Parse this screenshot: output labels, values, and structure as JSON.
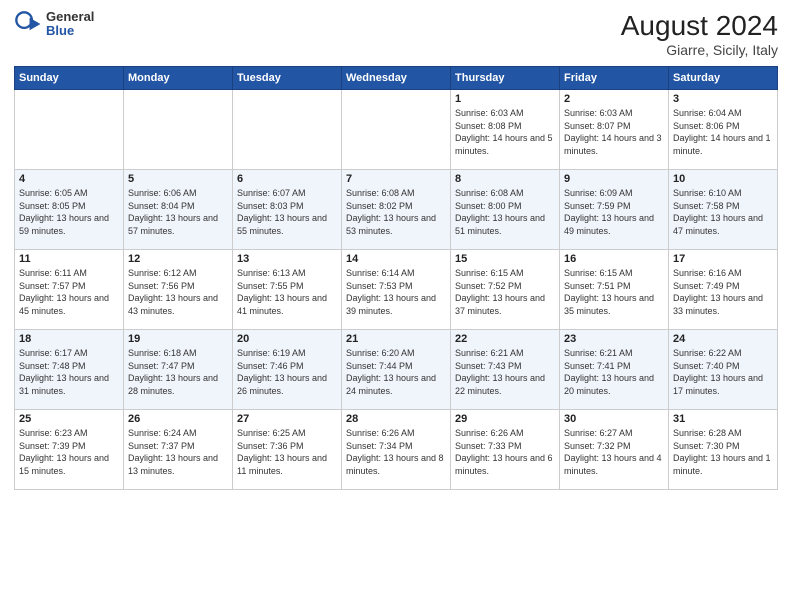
{
  "header": {
    "logo_general": "General",
    "logo_blue": "Blue",
    "title": "August 2024",
    "subtitle": "Giarre, Sicily, Italy"
  },
  "days_of_week": [
    "Sunday",
    "Monday",
    "Tuesday",
    "Wednesday",
    "Thursday",
    "Friday",
    "Saturday"
  ],
  "weeks": [
    [
      {
        "day": "",
        "empty": true
      },
      {
        "day": "",
        "empty": true
      },
      {
        "day": "",
        "empty": true
      },
      {
        "day": "",
        "empty": true
      },
      {
        "day": "1",
        "sunrise": "6:03 AM",
        "sunset": "8:08 PM",
        "daylight": "14 hours and 5 minutes."
      },
      {
        "day": "2",
        "sunrise": "6:03 AM",
        "sunset": "8:07 PM",
        "daylight": "14 hours and 3 minutes."
      },
      {
        "day": "3",
        "sunrise": "6:04 AM",
        "sunset": "8:06 PM",
        "daylight": "14 hours and 1 minute."
      }
    ],
    [
      {
        "day": "4",
        "sunrise": "6:05 AM",
        "sunset": "8:05 PM",
        "daylight": "13 hours and 59 minutes."
      },
      {
        "day": "5",
        "sunrise": "6:06 AM",
        "sunset": "8:04 PM",
        "daylight": "13 hours and 57 minutes."
      },
      {
        "day": "6",
        "sunrise": "6:07 AM",
        "sunset": "8:03 PM",
        "daylight": "13 hours and 55 minutes."
      },
      {
        "day": "7",
        "sunrise": "6:08 AM",
        "sunset": "8:02 PM",
        "daylight": "13 hours and 53 minutes."
      },
      {
        "day": "8",
        "sunrise": "6:08 AM",
        "sunset": "8:00 PM",
        "daylight": "13 hours and 51 minutes."
      },
      {
        "day": "9",
        "sunrise": "6:09 AM",
        "sunset": "7:59 PM",
        "daylight": "13 hours and 49 minutes."
      },
      {
        "day": "10",
        "sunrise": "6:10 AM",
        "sunset": "7:58 PM",
        "daylight": "13 hours and 47 minutes."
      }
    ],
    [
      {
        "day": "11",
        "sunrise": "6:11 AM",
        "sunset": "7:57 PM",
        "daylight": "13 hours and 45 minutes."
      },
      {
        "day": "12",
        "sunrise": "6:12 AM",
        "sunset": "7:56 PM",
        "daylight": "13 hours and 43 minutes."
      },
      {
        "day": "13",
        "sunrise": "6:13 AM",
        "sunset": "7:55 PM",
        "daylight": "13 hours and 41 minutes."
      },
      {
        "day": "14",
        "sunrise": "6:14 AM",
        "sunset": "7:53 PM",
        "daylight": "13 hours and 39 minutes."
      },
      {
        "day": "15",
        "sunrise": "6:15 AM",
        "sunset": "7:52 PM",
        "daylight": "13 hours and 37 minutes."
      },
      {
        "day": "16",
        "sunrise": "6:15 AM",
        "sunset": "7:51 PM",
        "daylight": "13 hours and 35 minutes."
      },
      {
        "day": "17",
        "sunrise": "6:16 AM",
        "sunset": "7:49 PM",
        "daylight": "13 hours and 33 minutes."
      }
    ],
    [
      {
        "day": "18",
        "sunrise": "6:17 AM",
        "sunset": "7:48 PM",
        "daylight": "13 hours and 31 minutes."
      },
      {
        "day": "19",
        "sunrise": "6:18 AM",
        "sunset": "7:47 PM",
        "daylight": "13 hours and 28 minutes."
      },
      {
        "day": "20",
        "sunrise": "6:19 AM",
        "sunset": "7:46 PM",
        "daylight": "13 hours and 26 minutes."
      },
      {
        "day": "21",
        "sunrise": "6:20 AM",
        "sunset": "7:44 PM",
        "daylight": "13 hours and 24 minutes."
      },
      {
        "day": "22",
        "sunrise": "6:21 AM",
        "sunset": "7:43 PM",
        "daylight": "13 hours and 22 minutes."
      },
      {
        "day": "23",
        "sunrise": "6:21 AM",
        "sunset": "7:41 PM",
        "daylight": "13 hours and 20 minutes."
      },
      {
        "day": "24",
        "sunrise": "6:22 AM",
        "sunset": "7:40 PM",
        "daylight": "13 hours and 17 minutes."
      }
    ],
    [
      {
        "day": "25",
        "sunrise": "6:23 AM",
        "sunset": "7:39 PM",
        "daylight": "13 hours and 15 minutes."
      },
      {
        "day": "26",
        "sunrise": "6:24 AM",
        "sunset": "7:37 PM",
        "daylight": "13 hours and 13 minutes."
      },
      {
        "day": "27",
        "sunrise": "6:25 AM",
        "sunset": "7:36 PM",
        "daylight": "13 hours and 11 minutes."
      },
      {
        "day": "28",
        "sunrise": "6:26 AM",
        "sunset": "7:34 PM",
        "daylight": "13 hours and 8 minutes."
      },
      {
        "day": "29",
        "sunrise": "6:26 AM",
        "sunset": "7:33 PM",
        "daylight": "13 hours and 6 minutes."
      },
      {
        "day": "30",
        "sunrise": "6:27 AM",
        "sunset": "7:32 PM",
        "daylight": "13 hours and 4 minutes."
      },
      {
        "day": "31",
        "sunrise": "6:28 AM",
        "sunset": "7:30 PM",
        "daylight": "13 hours and 1 minute."
      }
    ]
  ]
}
